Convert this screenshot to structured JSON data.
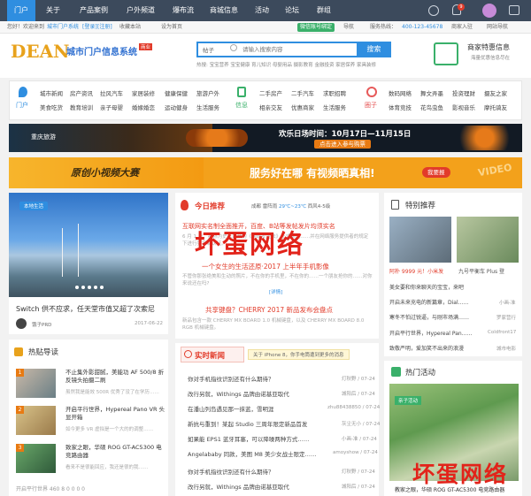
{
  "nav": {
    "items": [
      "门户",
      "关于",
      "产品案例",
      "户外频道",
      "爆布流",
      "商城信息",
      "活动",
      "论坛",
      "群组"
    ],
    "badge": "9"
  },
  "topbar": {
    "welcome": "您好！欢迎来到",
    "site": "城市门户系统",
    "login": "[登录]",
    "register": "[注册]",
    "collect": "收藏本站",
    "home_link": "设为首页",
    "wechat_btn": "微信账号绑定",
    "guide": "导航",
    "hotline_label": "服务热线：",
    "hotline": "400-123-45678",
    "merchant": "商家入驻",
    "shortcut": "网站导航"
  },
  "header": {
    "logo": "DEAN",
    "logo_sub": "城市门户信息系统",
    "logo_tag": "商业",
    "search_select": "帖子",
    "search_placeholder": "请输入搜索内容",
    "search_button": "搜索",
    "hot_words": [
      "热搜:",
      "宝宝营养",
      "宝宝健康",
      "育儿知识",
      "母婴用品",
      "摄影教育",
      "金融投资",
      "家居保养",
      "家具装修"
    ],
    "merchant_title": "商家特惠信息",
    "merchant_sub": "海量优惠信息尽在"
  },
  "categories": [
    {
      "label": "门户",
      "icon": "pin-icon",
      "color": "#2f8ee0",
      "items": [
        "城市新闻",
        "房产资讯",
        "拉风汽车",
        "家居装修",
        "健康保健",
        "旅游户外",
        "美食吃货",
        "教育培训",
        "亲子母婴",
        "婚嫁婚恋",
        "运动健身",
        "生活服务"
      ]
    },
    {
      "label": "信息",
      "icon": "phone-icon",
      "color": "#3ab06a",
      "items": [
        "二手房产",
        "二手汽车",
        "求职招聘",
        "相亲交友",
        "优惠商家",
        "生活服务"
      ]
    },
    {
      "label": "圈子",
      "icon": "circle-icon",
      "color": "#e75a5a",
      "items": [
        "数码网络",
        "舞文弄墨",
        "投资理财",
        "摄友之家",
        "体育竞技",
        "花鸟虫鱼",
        "影视音乐",
        "摩托骑友"
      ]
    }
  ],
  "banner1": {
    "left": "重庆旅游",
    "title": "欢乐日场时间：10月17日—11月15日",
    "cta": "点击进入参与购票"
  },
  "banner2": {
    "left": "原创小视频大赛",
    "title": "服务好在哪 有视频晒真相!",
    "cta": "我要报",
    "tag": "VIDEO"
  },
  "featured": {
    "tag": "本地生活",
    "headline": "Switch 供不应求，任天堂市值又超了次索尼",
    "author": "饿子PRD",
    "date": "2017-06-22"
  },
  "today": {
    "title": "今日推荐",
    "weather_label": "成都",
    "weather_cond": "雷阵雨",
    "weather_temp": "29℃~23℃",
    "weather_wind": "西风4-5级",
    "item1_title": "互联网实名制全面推开，百度、B站等发帖发片均须实名",
    "item1_desc": "6 月 1 日，被称为史上最严的《网络安全法》正式实施……并在网络服务提供者的规定下进行实名制认证。",
    "item2_title": "一个女生的生活还原·2017 上半年手机影像",
    "item2_desc": "不管你那张绝美和生动的照片，不在你的手机里，不在你的……一个朋友抢你的……对你来说还在吗? ",
    "item3_title": "共享键盘？CHERRY 2017 新品发布会盘点",
    "item3_desc": "新品包含一款 CHERRY MX BOARD 1.0 机械键盘，以及 CHERRY MX BOARD 8.0 RGB 机械键盘。",
    "more": "[详情]"
  },
  "realtime": {
    "title": "实时新闻",
    "tip": "关于 iPhone 8，你手电筒遭到更多的消息",
    "rows": [
      {
        "t": "你对手机指纹识别还有什么期待？",
        "a": "灯秋野",
        "d": "07-24"
      },
      {
        "t": "改行另就，Withings 品牌由诺基亚取代",
        "a": "城阳后",
        "d": "07-24"
      },
      {
        "t": "在潘山列岛遇见那一抹蓝，雪明涯",
        "a": "zhu88438850",
        "d": "07-24"
      },
      {
        "t": "新抗与重到！某起 Studio 三周年限定新品首发",
        "a": "灰尘无小",
        "d": "07-24"
      },
      {
        "t": "如果能 EPS1 蓝牙耳塞，可以降噪两种方式……",
        "a": "小画-准",
        "d": "07-24"
      },
      {
        "t": "Angelababy 同款，美图 M8 美少女战士限定……",
        "a": "amoyshow",
        "d": "07-24"
      },
      {
        "t": "你对手机指纹识别还有什么期待？",
        "a": "灯秋野",
        "d": "07-24"
      },
      {
        "t": "改行另就，Withings 品牌由诺基亚取代",
        "a": "城阳后",
        "d": "07-24"
      }
    ]
  },
  "hot": {
    "title": "热贴导读",
    "items": [
      {
        "n": "1",
        "t": "不止集外影甜腻，美能功 AF 500/8 折反镜头拍摄二刷",
        "d": "虽然我是能效 500R 优秀了没了在学历……"
      },
      {
        "n": "2",
        "t": "开启平行世界，Hypereal Pano VR 头显开箱",
        "d": "如今更多 VR 虚拟是一个大的的调整……"
      },
      {
        "n": "3",
        "t": "致家之眼，华硕 ROG GT-AC5300 电竞路由器",
        "d": "看来不是很能回应，我还是很的我……"
      }
    ],
    "more_row": "开启平行世界 460 8 0 0 0 0"
  },
  "special": {
    "title": "特别推荐",
    "cap1": "阿朴 9999 元！小米发",
    "cap2": "九号平衡车 Plus 登",
    "rows": [
      {
        "t": "美女要和你来聊天的宝宝，来吧",
        "a": ""
      },
      {
        "t": "开启未来充电的新篇章，Dial……",
        "a": "小画-准"
      },
      {
        "t": "寒冬不怕过锐逼，与刚市场满……",
        "a": "罗家营行"
      },
      {
        "t": "开启平行世界，Hypereal Pan……",
        "a": "Coldfront17"
      },
      {
        "t": "致敬严明，爱加笑不出来的浪漫",
        "a": "城市电影"
      }
    ]
  },
  "activity": {
    "title": "热门活动",
    "tag": "亲子活动",
    "caption": "教家之眼，华硕 ROG GT-AC5300 电竞路由器"
  },
  "watermark": {
    "big": "坏蛋网络",
    "small": "坏蛋网络"
  }
}
